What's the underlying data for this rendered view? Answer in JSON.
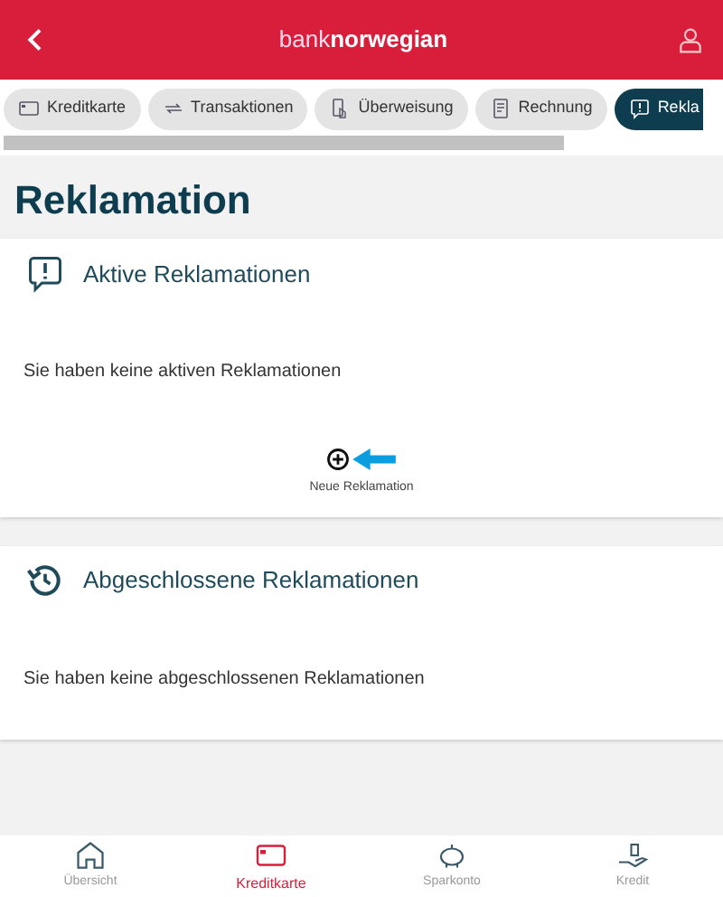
{
  "header": {
    "logo_light": "bank",
    "logo_bold": "norwegian"
  },
  "tabs": [
    {
      "label": "Kreditkarte",
      "selected": false
    },
    {
      "label": "Transaktionen",
      "selected": false
    },
    {
      "label": "Überweisung",
      "selected": false
    },
    {
      "label": "Rechnung",
      "selected": false
    },
    {
      "label": "Rekla",
      "selected": true
    }
  ],
  "page_title": "Reklamation",
  "sections": [
    {
      "title": "Aktive Reklamationen",
      "message": "Sie haben keine aktiven Reklamationen",
      "action": {
        "label": "Neue Reklamation"
      }
    },
    {
      "title": "Abgeschlossene Reklamationen",
      "message": "Sie haben keine abgeschlossenen Reklamationen"
    }
  ],
  "bottom_nav": [
    {
      "label": "Übersicht",
      "selected": false
    },
    {
      "label": "Kreditkarte",
      "selected": true
    },
    {
      "label": "Sparkonto",
      "selected": false
    },
    {
      "label": "Kredit",
      "selected": false
    }
  ]
}
